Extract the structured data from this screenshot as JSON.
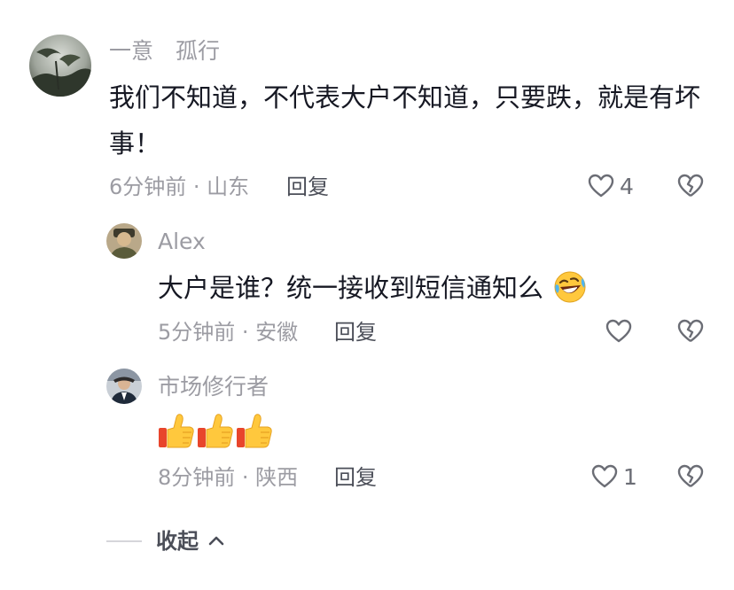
{
  "comments": [
    {
      "author": "一意　孤行",
      "text": "我们不知道，不代表大户不知道，只要跌，就是有坏事！",
      "meta": "6分钟前 · 山东",
      "reply_label": "回复",
      "like_count": "4",
      "replies": [
        {
          "author": "Alex",
          "text": "大户是谁？统一接收到短信通知么",
          "emoji": "rolling-laughing-emoji",
          "meta": "5分钟前 · 安徽",
          "reply_label": "回复",
          "like_count": ""
        },
        {
          "author": "市场修行者",
          "emoji": "thumbs-up-emoji ×3",
          "meta": "8分钟前 · 陕西",
          "reply_label": "回复",
          "like_count": "1"
        }
      ]
    }
  ],
  "collapse": {
    "label": "收起",
    "icon": "chevron-up-icon"
  },
  "icons": {
    "like": "heart-outline-icon",
    "dislike": "broken-heart-icon"
  },
  "colors": {
    "text": "#161823",
    "secondary": "#9c9ca3",
    "emoji_yellow": "#FFC83D"
  }
}
